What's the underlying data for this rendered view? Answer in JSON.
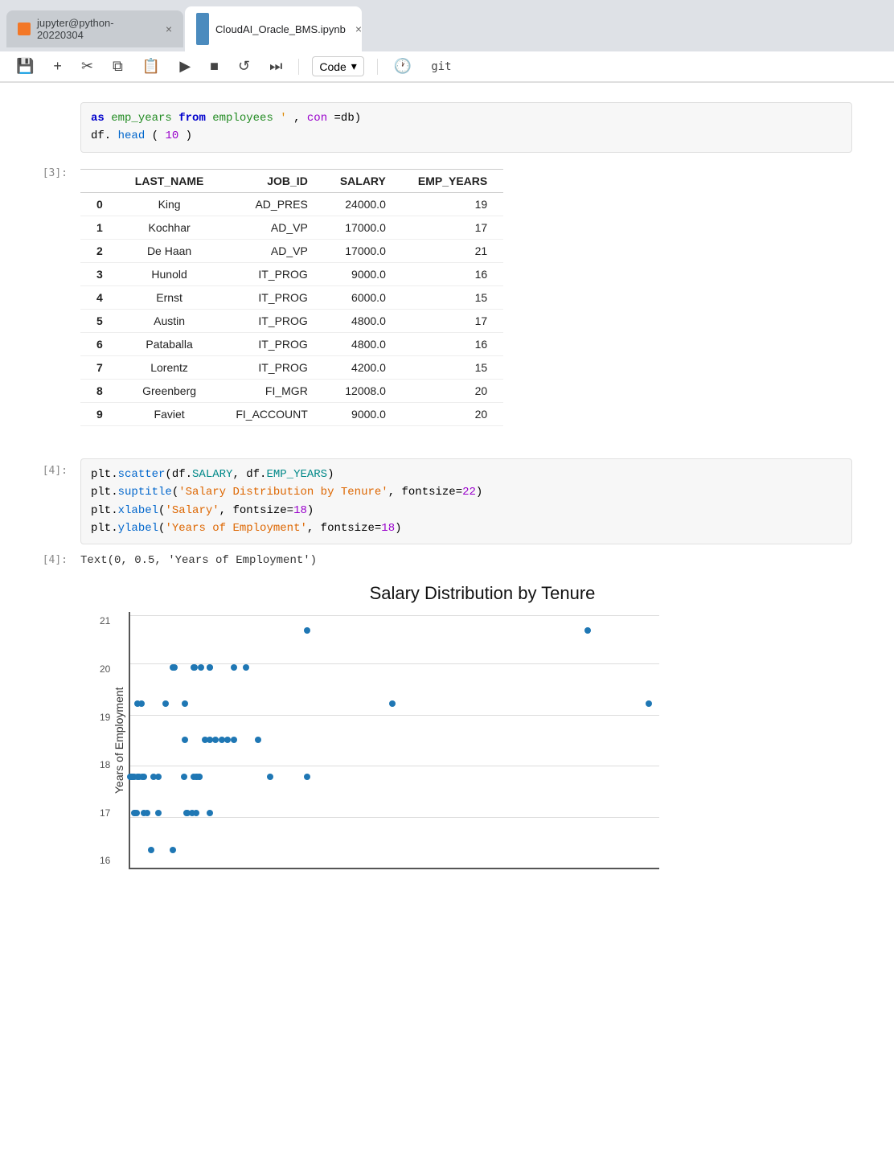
{
  "browser": {
    "tabs": [
      {
        "id": "jupyter-tab",
        "label": "jupyter@python-20220304",
        "icon": "jupyter",
        "active": false
      },
      {
        "id": "notebook-tab",
        "label": "CloudAI_Oracle_BMS.ipynb",
        "icon": "notebook",
        "active": true
      }
    ]
  },
  "toolbar": {
    "buttons": [
      "save",
      "add",
      "cut",
      "copy",
      "paste",
      "run",
      "stop",
      "restart",
      "fastforward"
    ],
    "cell_type": "Code",
    "extra": [
      "clock",
      "git"
    ]
  },
  "cells": {
    "cell3": {
      "number": "[3]:",
      "code_line1": "as emp_years from employees',",
      "code_con": "con",
      "code_db": "db",
      "code_line2": "df.",
      "code_head": "head",
      "code_10": "10",
      "table": {
        "headers": [
          "",
          "LAST_NAME",
          "JOB_ID",
          "SALARY",
          "EMP_YEARS"
        ],
        "rows": [
          [
            "0",
            "King",
            "AD_PRES",
            "24000.0",
            "19"
          ],
          [
            "1",
            "Kochhar",
            "AD_VP",
            "17000.0",
            "17"
          ],
          [
            "2",
            "De Haan",
            "AD_VP",
            "17000.0",
            "21"
          ],
          [
            "3",
            "Hunold",
            "IT_PROG",
            "9000.0",
            "16"
          ],
          [
            "4",
            "Ernst",
            "IT_PROG",
            "6000.0",
            "15"
          ],
          [
            "5",
            "Austin",
            "IT_PROG",
            "4800.0",
            "17"
          ],
          [
            "6",
            "Pataballa",
            "IT_PROG",
            "4800.0",
            "16"
          ],
          [
            "7",
            "Lorentz",
            "IT_PROG",
            "4200.0",
            "15"
          ],
          [
            "8",
            "Greenberg",
            "FI_MGR",
            "12008.0",
            "20"
          ],
          [
            "9",
            "Faviet",
            "FI_ACCOUNT",
            "9000.0",
            "20"
          ]
        ]
      }
    },
    "cell4_input": {
      "number": "[4]:",
      "lines": [
        {
          "parts": [
            {
              "text": "plt.",
              "color": "default"
            },
            {
              "text": "scatter",
              "color": "fn-blue"
            },
            {
              "text": "(df.",
              "color": "default"
            },
            {
              "text": "SALARY",
              "color": "fn-teal"
            },
            {
              "text": ", df.",
              "color": "default"
            },
            {
              "text": "EMP_YEARS",
              "color": "fn-teal"
            },
            {
              "text": ")",
              "color": "default"
            }
          ]
        },
        {
          "parts": [
            {
              "text": "plt.",
              "color": "default"
            },
            {
              "text": "suptitle",
              "color": "fn-blue"
            },
            {
              "text": "(",
              "color": "default"
            },
            {
              "text": "'Salary Distribution by Tenure'",
              "color": "str-orange"
            },
            {
              "text": ", fontsize=",
              "color": "default"
            },
            {
              "text": "22",
              "color": "num-purple"
            },
            {
              "text": ")",
              "color": "default"
            }
          ]
        },
        {
          "parts": [
            {
              "text": "plt.",
              "color": "default"
            },
            {
              "text": "xlabel",
              "color": "fn-blue"
            },
            {
              "text": "(",
              "color": "default"
            },
            {
              "text": "'Salary'",
              "color": "str-orange"
            },
            {
              "text": ", fontsize=",
              "color": "default"
            },
            {
              "text": "18",
              "color": "num-purple"
            },
            {
              "text": ")",
              "color": "default"
            }
          ]
        },
        {
          "parts": [
            {
              "text": "plt.",
              "color": "default"
            },
            {
              "text": "ylabel",
              "color": "fn-blue"
            },
            {
              "text": "(",
              "color": "default"
            },
            {
              "text": "'Years of Employment'",
              "color": "str-orange"
            },
            {
              "text": ", fontsize=",
              "color": "default"
            },
            {
              "text": "18",
              "color": "num-purple"
            },
            {
              "text": ")",
              "color": "default"
            }
          ]
        }
      ]
    },
    "cell4_output": {
      "number": "[4]:",
      "text": "Text(0, 0.5, 'Years of Employment')"
    },
    "chart": {
      "title": "Salary Distribution by Tenure",
      "ylabel": "Years of Employment",
      "yticks": [
        "16",
        "17",
        "18",
        "19",
        "20",
        "21"
      ],
      "dots": [
        {
          "salary": 24000,
          "years": 19
        },
        {
          "salary": 17000,
          "years": 17
        },
        {
          "salary": 17000,
          "years": 21
        },
        {
          "salary": 9000,
          "years": 16
        },
        {
          "salary": 6000,
          "years": 15
        },
        {
          "salary": 4800,
          "years": 17
        },
        {
          "salary": 4800,
          "years": 16
        },
        {
          "salary": 4200,
          "years": 15
        },
        {
          "salary": 12008,
          "years": 20
        },
        {
          "salary": 9000,
          "years": 20
        },
        {
          "salary": 3100,
          "years": 19
        },
        {
          "salary": 3400,
          "years": 19
        },
        {
          "salary": 2900,
          "years": 16
        },
        {
          "salary": 3000,
          "years": 16
        },
        {
          "salary": 2800,
          "years": 17
        },
        {
          "salary": 2500,
          "years": 17
        },
        {
          "salary": 2700,
          "years": 17
        },
        {
          "salary": 2700,
          "years": 17
        },
        {
          "salary": 2600,
          "years": 17
        },
        {
          "salary": 2600,
          "years": 17
        },
        {
          "salary": 2600,
          "years": 17
        },
        {
          "salary": 3200,
          "years": 17
        },
        {
          "salary": 3100,
          "years": 17
        },
        {
          "salary": 3500,
          "years": 17
        },
        {
          "salary": 3600,
          "years": 17
        },
        {
          "salary": 4400,
          "years": 17
        },
        {
          "salary": 7700,
          "years": 17
        },
        {
          "salary": 6900,
          "years": 17
        },
        {
          "salary": 8200,
          "years": 17
        },
        {
          "salary": 7900,
          "years": 17
        },
        {
          "salary": 8200,
          "years": 17
        },
        {
          "salary": 8000,
          "years": 17
        },
        {
          "salary": 11000,
          "years": 20
        },
        {
          "salary": 6000,
          "years": 20
        },
        {
          "salary": 8300,
          "years": 20
        },
        {
          "salary": 7800,
          "years": 20
        },
        {
          "salary": 7700,
          "years": 20
        },
        {
          "salary": 9000,
          "years": 20
        },
        {
          "salary": 6100,
          "years": 20
        },
        {
          "salary": 8600,
          "years": 18
        },
        {
          "salary": 7000,
          "years": 18
        },
        {
          "salary": 9500,
          "years": 18
        },
        {
          "salary": 9000,
          "years": 18
        },
        {
          "salary": 10000,
          "years": 18
        },
        {
          "salary": 10500,
          "years": 18
        },
        {
          "salary": 11000,
          "years": 18
        },
        {
          "salary": 13000,
          "years": 18
        },
        {
          "salary": 7000,
          "years": 19
        },
        {
          "salary": 5400,
          "years": 19
        },
        {
          "salary": 2800,
          "years": 16
        },
        {
          "salary": 3600,
          "years": 16
        },
        {
          "salary": 3900,
          "years": 16
        },
        {
          "salary": 7600,
          "years": 16
        },
        {
          "salary": 7900,
          "years": 16
        },
        {
          "salary": 7200,
          "years": 16
        },
        {
          "salary": 7100,
          "years": 16
        },
        {
          "salary": 14000,
          "years": 17
        },
        {
          "salary": 40000,
          "years": 21
        },
        {
          "salary": 45000,
          "years": 19
        }
      ]
    }
  }
}
